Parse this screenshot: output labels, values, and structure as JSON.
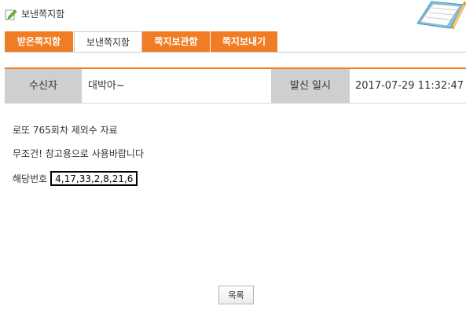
{
  "header": {
    "title": "보낸쪽지함",
    "pencil_icon": "pencil-icon",
    "notebook_icon": "notebook-icon"
  },
  "tabs": [
    {
      "label": "받은쪽지함",
      "active": false
    },
    {
      "label": "보낸쪽지함",
      "active": true
    },
    {
      "label": "쪽지보관함",
      "active": false
    },
    {
      "label": "쪽지보내기",
      "active": false
    }
  ],
  "meta": {
    "recipient_label": "수신자",
    "recipient_value": "대박아~",
    "sent_label": "발신 일시",
    "sent_value": "2017-07-29 11:32:47"
  },
  "message": {
    "line1": "로또 765회차 제외수 자료",
    "line2": "무조건! 참고용으로 사용바랍니다",
    "numbers_label": "해당번호",
    "numbers_value": "4,17,33,2,8,21,6"
  },
  "buttons": {
    "list_label": "목록"
  },
  "colors": {
    "accent": "#f07c23",
    "label_bg": "#cfcfcf"
  }
}
